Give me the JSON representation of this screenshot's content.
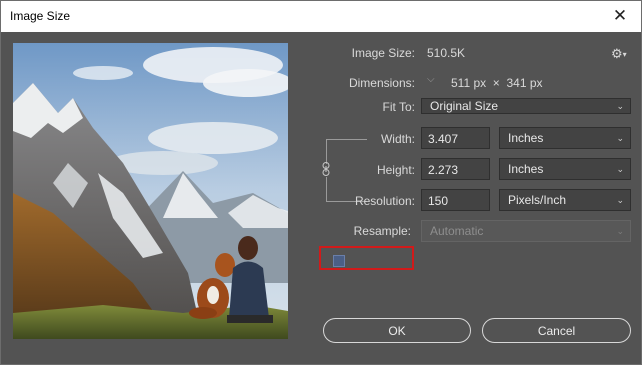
{
  "window": {
    "title": "Image Size",
    "close_glyph": "✕"
  },
  "image_size": {
    "label": "Image Size:",
    "value": "510.5K"
  },
  "dimensions": {
    "label": "Dimensions:",
    "value": "511 px  ×  341 px"
  },
  "fit_to": {
    "label": "Fit To:",
    "selected": "Original Size"
  },
  "width": {
    "label": "Width:",
    "value": "3.407",
    "unit": "Inches"
  },
  "height": {
    "label": "Height:",
    "value": "2.273",
    "unit": "Inches"
  },
  "resolution": {
    "label": "Resolution:",
    "value": "150",
    "unit": "Pixels/Inch"
  },
  "resample": {
    "label": "Resample:",
    "selected": "Automatic",
    "checked": false,
    "highlight_color": "#d11a1a"
  },
  "buttons": {
    "ok": "OK",
    "cancel": "Cancel"
  },
  "icons": {
    "gear": "gear-icon",
    "close": "close-icon",
    "link": "link-chain-icon",
    "chevron": "chevron-down-icon"
  },
  "colors": {
    "panel": "#535353",
    "field": "#434343",
    "text": "#d9d9d9"
  }
}
